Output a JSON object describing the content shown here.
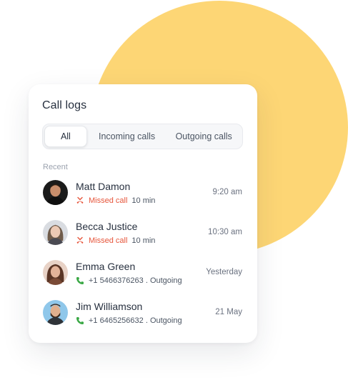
{
  "card": {
    "title": "Call logs",
    "tabs": [
      {
        "label": "All",
        "active": true
      },
      {
        "label": "Incoming calls",
        "active": false
      },
      {
        "label": "Outgoing calls",
        "active": false
      }
    ],
    "section_label": "Recent"
  },
  "calls": [
    {
      "name": "Matt Damon",
      "status": "Missed call",
      "duration": "10 min",
      "time": "9:20 am",
      "icon": "missed-call-icon"
    },
    {
      "name": "Becca Justice",
      "status": "Missed call",
      "duration": "10 min",
      "time": "10:30 am",
      "icon": "missed-call-icon"
    },
    {
      "name": "Emma Green",
      "detail": "+1 5466376263 . Outgoing",
      "time": "Yesterday",
      "icon": "phone-icon"
    },
    {
      "name": "Jim Williamson",
      "detail": "+1 6465256632 . Outgoing",
      "time": "21 May",
      "icon": "phone-icon"
    }
  ],
  "colors": {
    "accent_blob": "#fdd675",
    "missed": "#e6553b",
    "outgoing": "#3aa845",
    "text_primary": "#27303f",
    "text_secondary": "#6b7280"
  }
}
